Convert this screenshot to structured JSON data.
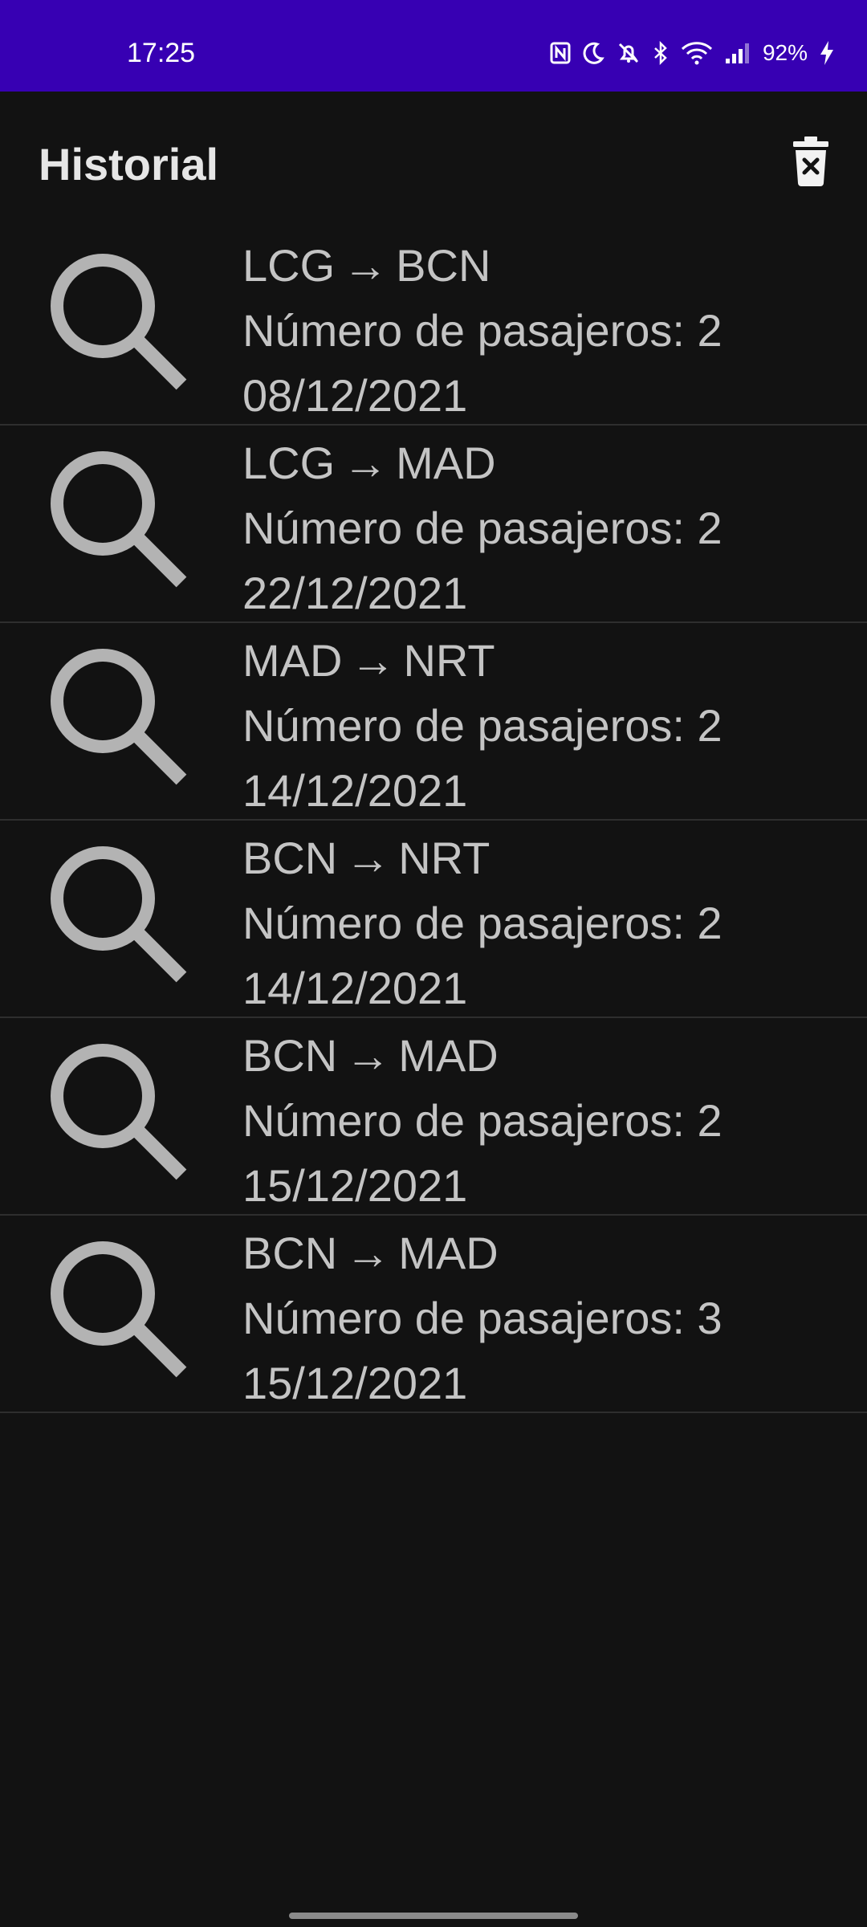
{
  "status_bar": {
    "time": "17:25",
    "battery": "92%",
    "icons": [
      "nfc-icon",
      "do-not-disturb-icon",
      "bell-off-icon",
      "bluetooth-icon",
      "wifi-icon",
      "signal-icon",
      "charging-icon"
    ],
    "background": "#3700b3"
  },
  "header": {
    "title": "Historial",
    "delete_icon": "delete-forever-icon"
  },
  "history": [
    {
      "origin": "LCG",
      "arrow": "→",
      "destination": "BCN",
      "passengers": "Número de pasajeros: 2",
      "date": "08/12/2021"
    },
    {
      "origin": "LCG",
      "arrow": "→",
      "destination": "MAD",
      "passengers": "Número de pasajeros: 2",
      "date": "22/12/2021"
    },
    {
      "origin": "MAD",
      "arrow": "→",
      "destination": "NRT",
      "passengers": "Número de pasajeros: 2",
      "date": "14/12/2021"
    },
    {
      "origin": "BCN",
      "arrow": "→",
      "destination": "NRT",
      "passengers": "Número de pasajeros: 2",
      "date": "14/12/2021"
    },
    {
      "origin": "BCN",
      "arrow": "→",
      "destination": "MAD",
      "passengers": "Número de pasajeros: 2",
      "date": "15/12/2021"
    },
    {
      "origin": "BCN",
      "arrow": "→",
      "destination": "MAD",
      "passengers": "Número de pasajeros: 3",
      "date": "15/12/2021"
    }
  ],
  "colors": {
    "background": "#121212",
    "text": "#c4c4c4",
    "icon": "#b3b3b3",
    "divider": "#2e2e2e"
  }
}
